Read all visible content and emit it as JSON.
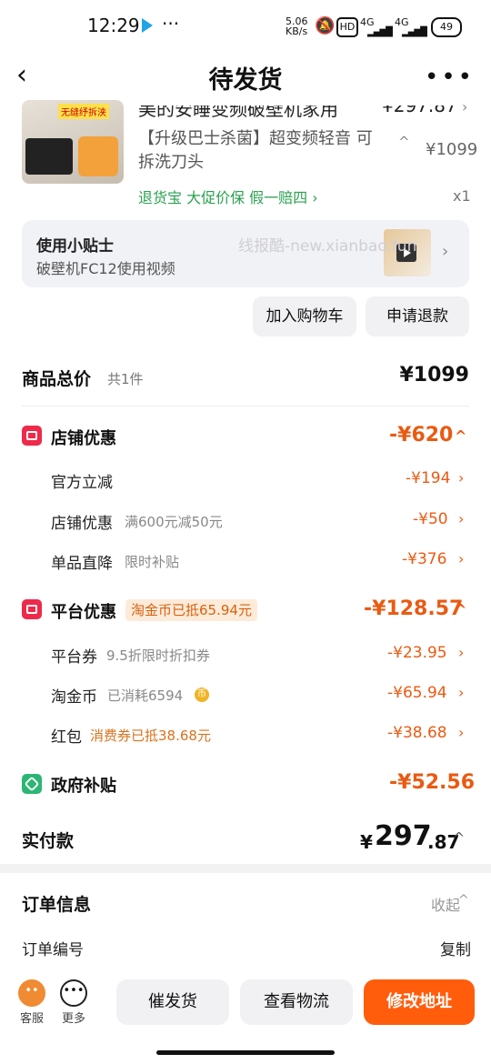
{
  "status_bar": {
    "time": "12:29",
    "net_speed": "5.06\nKB/s",
    "hd_label": "HD",
    "network_1": "4G",
    "network_2": "4G",
    "battery": "49"
  },
  "nav": {
    "title": "待发货"
  },
  "product": {
    "title_partial": "美的安睡变频破壁机家用",
    "price_partial": "¥297.87",
    "description": "【升级巴士杀菌】超变频轻音 可拆洗刀头",
    "original_price": "¥1099",
    "services": "退货宝  大促价保  假一赔四 ›",
    "quantity": "x1",
    "image_tag": "无缝纾拆浃"
  },
  "tips": {
    "title": "使用小贴士",
    "subtitle": "破壁机FC12使用视频",
    "watermark": "线报酷-new.xianbao.fun"
  },
  "actions": {
    "add_to_cart": "加入购物车",
    "apply_refund": "申请退款"
  },
  "summary": {
    "label": "商品总价",
    "count": "共1件",
    "total": "¥1099"
  },
  "shop_discount": {
    "label": "店铺优惠",
    "amount": "-¥620",
    "rows": [
      {
        "label": "官方立减",
        "note": "",
        "amount": "-¥194"
      },
      {
        "label": "店铺优惠",
        "note": "满600元减50元",
        "amount": "-¥50"
      },
      {
        "label": "单品直降",
        "note": "限时补贴",
        "amount": "-¥376"
      }
    ]
  },
  "platform_discount": {
    "label": "平台优惠",
    "pill": "淘金币已抵65.94元",
    "amount": "-¥128.57",
    "rows": [
      {
        "label": "平台券",
        "note": "9.5折限时折扣券",
        "amount": "-¥23.95"
      },
      {
        "label": "淘金币",
        "note": "已消耗6594",
        "amount": "-¥65.94"
      },
      {
        "label": "红包",
        "note": "消费券已抵38.68元",
        "amount": "-¥38.68"
      }
    ]
  },
  "gov_subsidy": {
    "label": "政府补贴",
    "amount": "-¥52.56"
  },
  "paid": {
    "label": "实付款",
    "yen": "¥",
    "integer": "297",
    "decimal": ".87"
  },
  "order": {
    "title": "订单信息",
    "fold": "收起",
    "number_label": "订单编号",
    "copy": "复制"
  },
  "bottom": {
    "service": "客服",
    "more": "更多",
    "urge": "催发货",
    "logistics": "查看物流",
    "modify_address": "修改地址"
  }
}
